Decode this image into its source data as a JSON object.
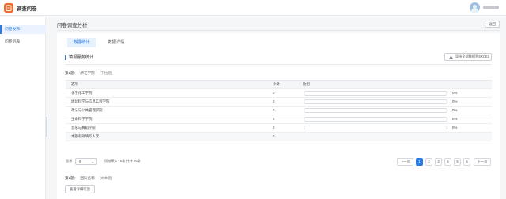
{
  "header": {
    "app_title": "调查问卷"
  },
  "sidebar": {
    "items": [
      {
        "label": "问卷发布"
      },
      {
        "label": "问卷列表"
      }
    ]
  },
  "page": {
    "title": "问卷调查分析",
    "return_label": "返回"
  },
  "tabs": [
    {
      "label": "数据统计"
    },
    {
      "label": "数据详情"
    }
  ],
  "section": {
    "title": "填报服务统计",
    "export_label": "导出全部数据到EXCEL"
  },
  "question1": {
    "number": "第1题：",
    "text": "所在学院",
    "type": "[下拉题]"
  },
  "table": {
    "columns": [
      "选项",
      "小计",
      "比例"
    ],
    "rows": [
      {
        "option": "化学化工学院",
        "count": "0",
        "ratio": "0%",
        "fill": 0
      },
      {
        "option": "地球科学与信息工程学院",
        "count": "0",
        "ratio": "0%",
        "fill": 0
      },
      {
        "option": "政法与公共管理学院",
        "count": "0",
        "ratio": "0%",
        "fill": 0
      },
      {
        "option": "生命科学学院",
        "count": "0",
        "ratio": "0%",
        "fill": 0
      },
      {
        "option": "音乐与舞蹈学院",
        "count": "0",
        "ratio": "0%",
        "fill": 0
      }
    ],
    "total_label": "本题有效填写人次",
    "total_value": "0"
  },
  "pagination": {
    "show_label": "显示",
    "page_size": "5",
    "range_text": "项结果 1 - 5条 共计 26条",
    "prev_label": "上一页",
    "next_label": "下一页",
    "pages": [
      "1",
      "2",
      "3",
      "4",
      "5",
      "6"
    ],
    "current_page": "1"
  },
  "question2": {
    "number": "第2题：",
    "text": "团队名称",
    "type": "[文本题]",
    "button_label": "查看详细信息"
  },
  "colors": {
    "accent": "#2c7be5",
    "brand": "#ee6b2d"
  }
}
